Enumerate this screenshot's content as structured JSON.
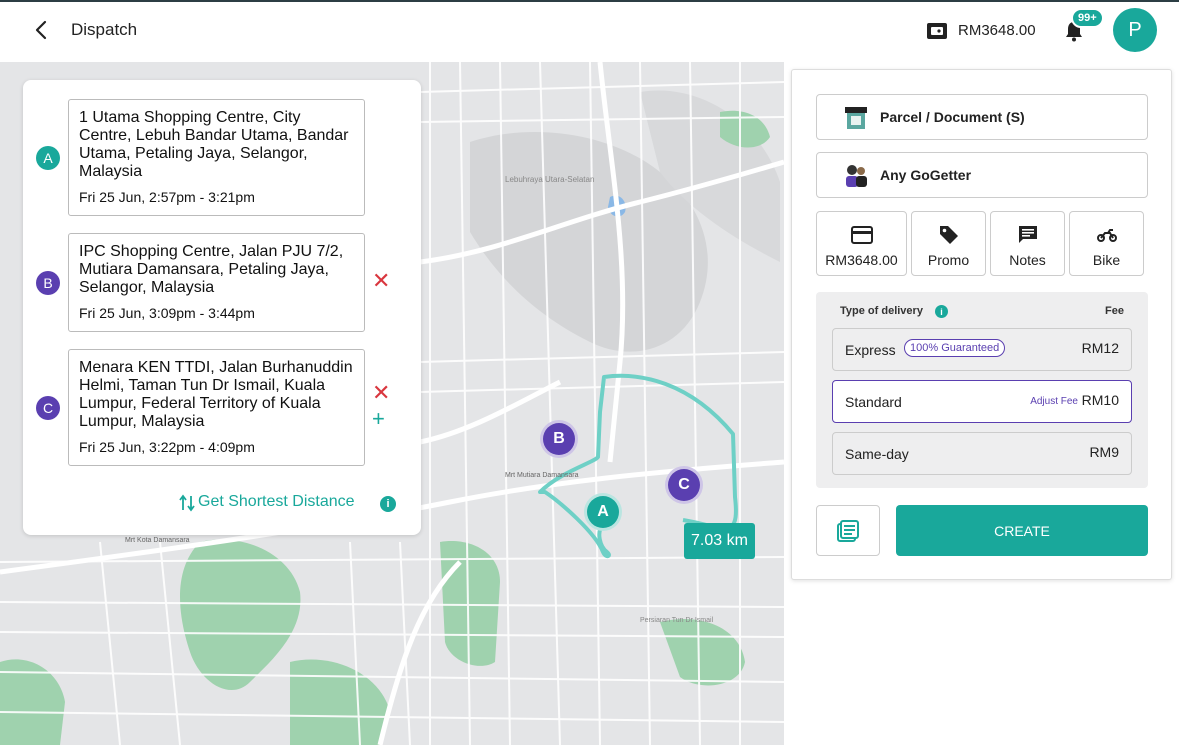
{
  "header": {
    "title": "Dispatch",
    "wallet_balance": "RM3648.00",
    "notification_count": "99+",
    "avatar_initial": "P"
  },
  "stops": [
    {
      "letter": "A",
      "address": "1 Utama Shopping Centre, City Centre, Lebuh Bandar Utama, Bandar Utama, Petaling Jaya, Selangor, Malaysia",
      "time": "Fri 25 Jun, 2:57pm - 3:21pm",
      "color": "#19a89b"
    },
    {
      "letter": "B",
      "address": "IPC Shopping Centre, Jalan PJU 7/2, Mutiara Damansara, Petaling Jaya, Selangor, Malaysia",
      "time": "Fri 25 Jun, 3:09pm - 3:44pm",
      "color": "#5a3fb0"
    },
    {
      "letter": "C",
      "address": "Menara KEN TTDI, Jalan Burhanuddin Helmi, Taman Tun Dr Ismail, Kuala Lumpur, Federal Territory of Kuala Lumpur, Malaysia",
      "time": "Fri 25 Jun, 3:22pm - 4:09pm",
      "color": "#5a3fb0"
    }
  ],
  "route": {
    "shortest_label": "Get Shortest Distance",
    "distance": "7.03 km"
  },
  "panel": {
    "parcel_type": "Parcel / Document (S)",
    "driver": "Any GoGetter",
    "options": {
      "payment": "RM3648.00",
      "promo": "Promo",
      "notes": "Notes",
      "vehicle": "Bike"
    },
    "delivery": {
      "header": "Type of delivery",
      "fee_header": "Fee",
      "types": [
        {
          "name": "Express",
          "tag": "100% Guaranteed",
          "price": "RM12"
        },
        {
          "name": "Standard",
          "adjust": "Adjust Fee",
          "price": "RM10"
        },
        {
          "name": "Same-day",
          "price": "RM9"
        }
      ],
      "selected": "Standard"
    },
    "create_label": "CREATE"
  },
  "map_labels": {
    "mutiara": "Mrt Mutiara Damansara",
    "kota": "Mrt Kota Damansara",
    "lebuhraya": "Lebuhraya Utara-Selatan",
    "ttdi": "Persiaran Tun Dr Ismail"
  },
  "colors": {
    "accent": "#19a89b",
    "purple": "#5a3fb0",
    "danger": "#d9363e"
  }
}
